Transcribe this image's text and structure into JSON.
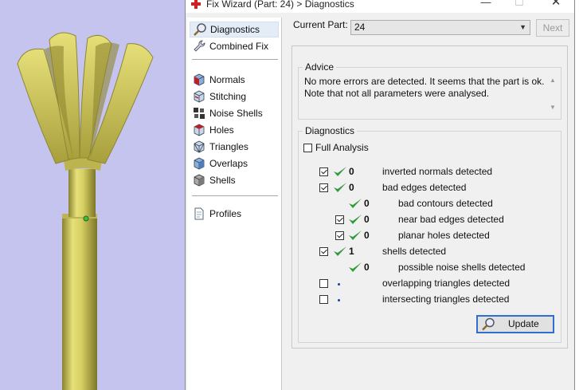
{
  "window": {
    "title": "Fix Wizard (Part: 24) > Diagnostics",
    "minimize": "—",
    "maximize": "☐",
    "close": "✕"
  },
  "sidebar": {
    "items": [
      {
        "label": "Diagnostics",
        "icon": "magnifier-icon",
        "selected": true
      },
      {
        "label": "Combined Fix",
        "icon": "wrench-icon"
      },
      {
        "label": "Normals",
        "icon": "normals-cube-icon"
      },
      {
        "label": "Stitching",
        "icon": "stitching-cube-icon"
      },
      {
        "label": "Noise Shells",
        "icon": "noise-shells-icon"
      },
      {
        "label": "Holes",
        "icon": "holes-cube-icon"
      },
      {
        "label": "Triangles",
        "icon": "triangles-cube-icon"
      },
      {
        "label": "Overlaps",
        "icon": "overlaps-cube-icon"
      },
      {
        "label": "Shells",
        "icon": "shells-cube-icon"
      },
      {
        "label": "Profiles",
        "icon": "document-icon"
      }
    ]
  },
  "header": {
    "current_part_label": "Current Part:",
    "current_part_value": "24",
    "next_label": "Next"
  },
  "advice": {
    "title": "Advice",
    "line1": "No more errors are detected. It seems that the part is ok.",
    "line2": "Note that not all parameters were analysed."
  },
  "diagnostics": {
    "title": "Diagnostics",
    "full_analysis_label": "Full Analysis",
    "full_analysis_checked": false,
    "rows": [
      {
        "count": "0",
        "label": "inverted normals detected",
        "checked": true,
        "status": "ok",
        "indent": 0
      },
      {
        "count": "0",
        "label": "bad edges detected",
        "checked": true,
        "status": "ok",
        "indent": 0
      },
      {
        "count": "0",
        "label": "bad contours detected",
        "checked": null,
        "status": "ok",
        "indent": 1
      },
      {
        "count": "0",
        "label": "near bad edges detected",
        "checked": true,
        "status": "ok",
        "indent": 1
      },
      {
        "count": "0",
        "label": "planar holes detected",
        "checked": true,
        "status": "ok",
        "indent": 1
      },
      {
        "count": "1",
        "label": "shells detected",
        "checked": true,
        "status": "ok",
        "indent": 0
      },
      {
        "count": "0",
        "label": "possible noise shells detected",
        "checked": null,
        "status": "ok",
        "indent": 1
      },
      {
        "count": "",
        "label": "overlapping triangles detected",
        "checked": false,
        "status": "pending",
        "indent": 0
      },
      {
        "count": "",
        "label": "intersecting triangles detected",
        "checked": false,
        "status": "pending",
        "indent": 0
      }
    ],
    "update_label": "Update"
  },
  "colors": {
    "viewport_bg": "#c4c4ee",
    "model_yellow": "#d6cf62",
    "check_green": "#2e9a3a",
    "accent_blue": "#2f6fd0"
  }
}
